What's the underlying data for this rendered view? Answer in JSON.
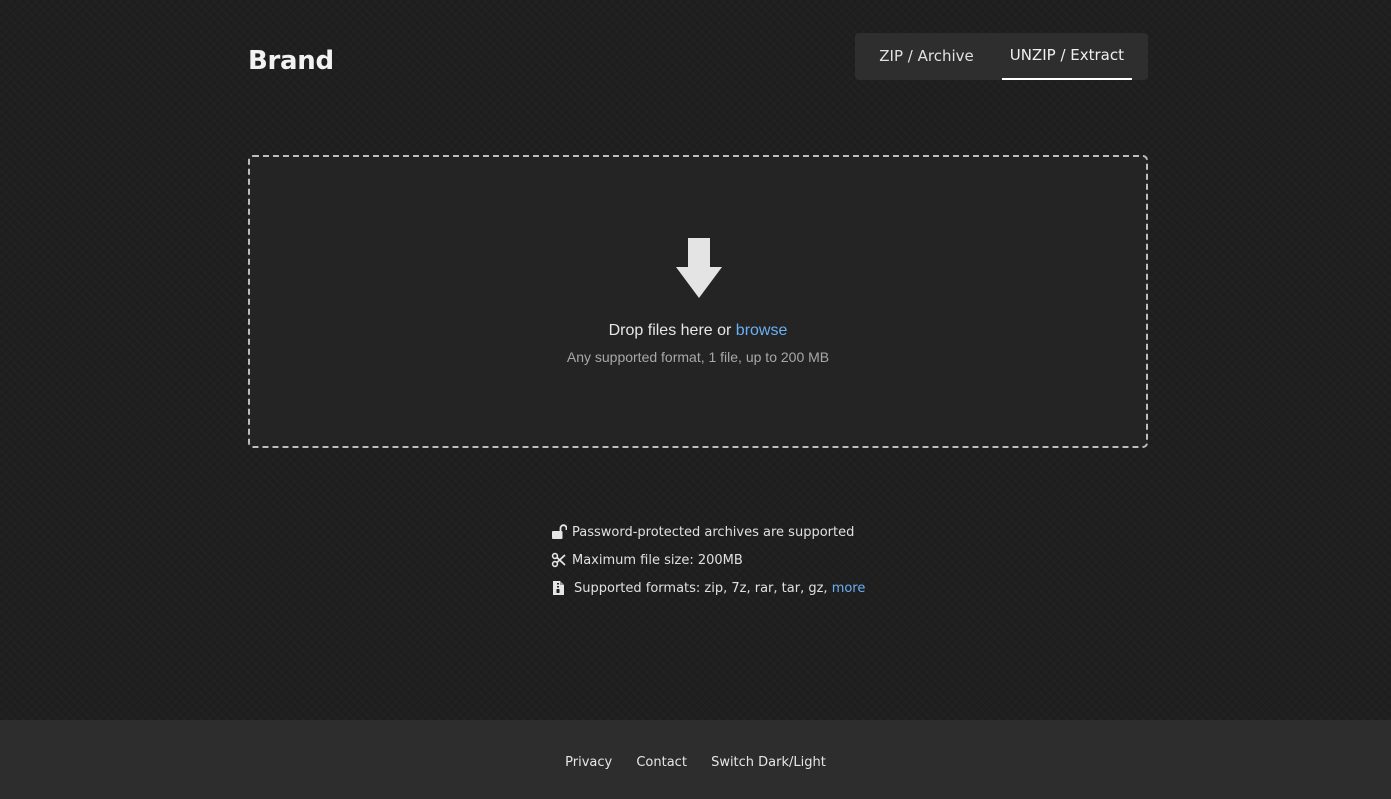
{
  "header": {
    "brand": "Brand",
    "tabs": [
      {
        "label": "ZIP / Archive",
        "active": false
      },
      {
        "label": "UNZIP / Extract",
        "active": true
      }
    ]
  },
  "dropzone": {
    "prompt": "Drop files here or",
    "browse_label": "browse",
    "hint": "Any supported format, 1 file, up to 200 MB",
    "icon": "download-arrow-icon"
  },
  "features": {
    "password": {
      "icon": "unlock-icon",
      "text": "Password-protected archives are supported"
    },
    "max_size": {
      "icon": "scissors-icon",
      "text": "Maximum file size: 200MB"
    },
    "formats": {
      "icon": "file-archive-icon",
      "text": "Supported formats: zip, 7z, rar, tar, gz,",
      "more_label": "more"
    }
  },
  "footer": {
    "links": [
      "Privacy",
      "Contact",
      "Switch Dark/Light"
    ]
  },
  "colors": {
    "background": "#1f1f1f",
    "footer": "#2d2d2d",
    "tabs_bg": "#2e2e2e",
    "link": "#6ab0f3"
  }
}
